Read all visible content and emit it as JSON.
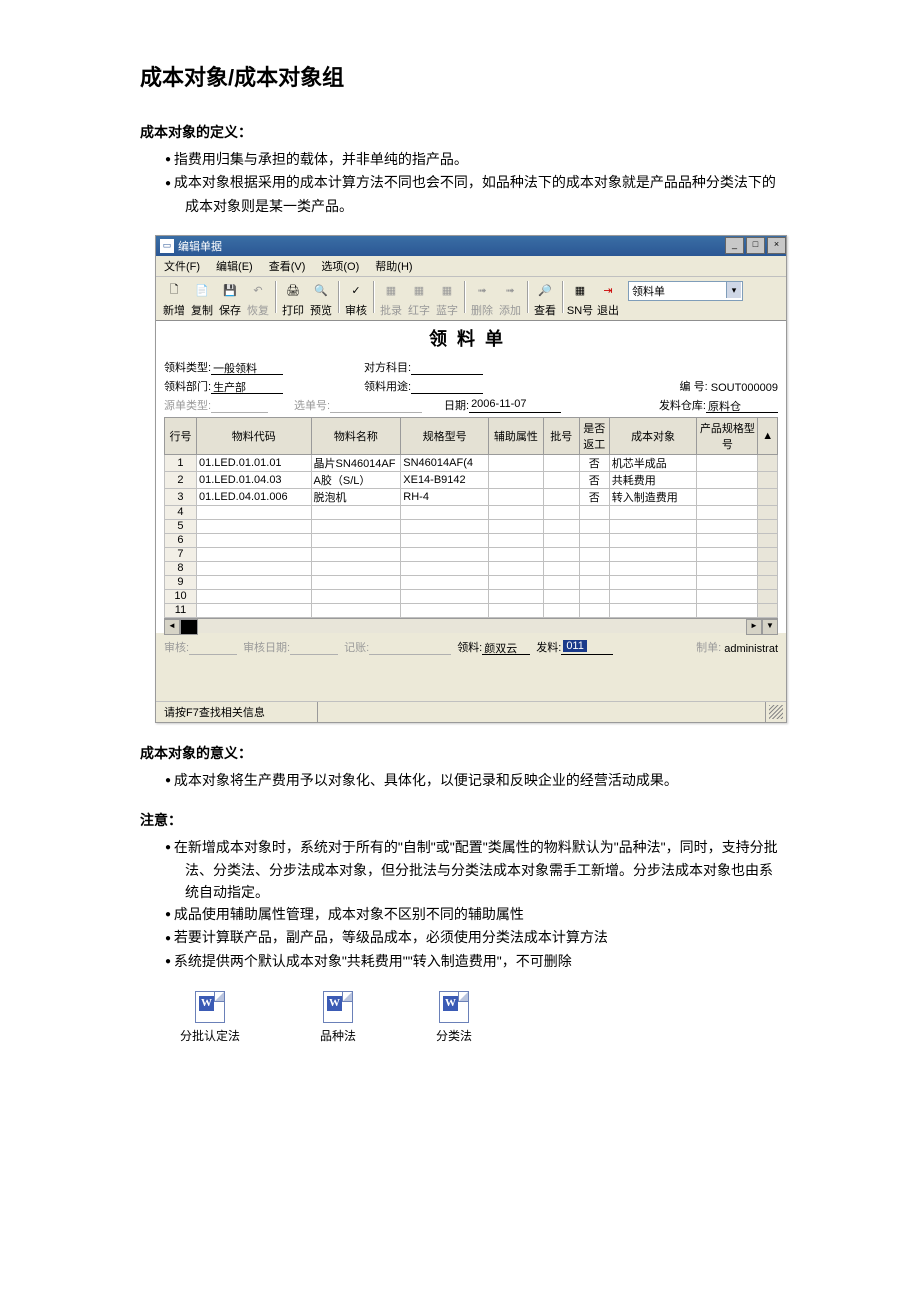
{
  "doc": {
    "title": "成本对象/成本对象组",
    "def_heading": "成本对象的定义：",
    "def_bullets": [
      "指费用归集与承担的载体，并非单纯的指产品。",
      "成本对象根据采用的成本计算方法不同也会不同，如品种法下的成本对象就是产品品种分类法下的成本对象则是某一类产品。"
    ],
    "meaning_heading": "成本对象的意义：",
    "meaning_bullets": [
      "成本对象将生产费用予以对象化、具体化，以便记录和反映企业的经营活动成果。"
    ],
    "note_heading": "注意：",
    "note_bullets": [
      "在新增成本对象时，系统对于所有的\"自制\"或\"配置\"类属性的物料默认为\"品种法\"，同时，支持分批法、分类法、分步法成本对象，但分批法与分类法成本对象需手工新增。分步法成本对象也由系统自动指定。",
      "成品使用辅助属性管理，成本对象不区别不同的辅助属性",
      "若要计算联产品，副产品，等级品成本，必须使用分类法成本计算方法",
      "系统提供两个默认成本对象\"共耗费用\"\"转入制造费用\"，不可删除"
    ],
    "word_docs": [
      "分批认定法",
      "品种法",
      "分类法"
    ]
  },
  "app": {
    "title": "编辑单据",
    "menus": {
      "file": "文件(F)",
      "edit": "编辑(E)",
      "view": "查看(V)",
      "option": "选项(O)",
      "help": "帮助(H)"
    },
    "tools": [
      "新增",
      "复制",
      "保存",
      "恢复",
      "打印",
      "预览",
      "审核",
      "批录",
      "红字",
      "蓝字",
      "删除",
      "添加",
      "查看",
      "SN号",
      "退出"
    ],
    "combo": "领料单",
    "form": {
      "doc_title": "领料单",
      "fields": {
        "type_label": "领料类型:",
        "type_value": "一般领料",
        "dept_label": "领料部门:",
        "dept_value": "生产部",
        "account_label": "对方科目:",
        "account_value": "",
        "purpose_label": "领料用途:",
        "purpose_value": "",
        "no_label": "编       号:",
        "no_value": "SOUT000009",
        "src_label": "源单类型:",
        "src_value": "",
        "selno_label": "选单号:",
        "selno_value": "",
        "date_label": "日期:",
        "date_value": "2006-11-07",
        "store_label": "发料仓库:",
        "store_value": "原料仓"
      },
      "columns": [
        "行号",
        "物料代码",
        "物料名称",
        "规格型号",
        "辅助属性",
        "批号",
        "是否返工",
        "成本对象",
        "产品规格型号"
      ],
      "rows": [
        {
          "n": "1",
          "code": "01.LED.01.01.01",
          "name": "晶片SN46014AF",
          "spec": "SN46014AF(4",
          "aux": "",
          "batch": "",
          "rework": "否",
          "obj": "机芯半成品",
          "pspec": ""
        },
        {
          "n": "2",
          "code": "01.LED.01.04.03",
          "name": "A胶（S/L）",
          "spec": "XE14-B9142",
          "aux": "",
          "batch": "",
          "rework": "否",
          "obj": "共耗费用",
          "pspec": ""
        },
        {
          "n": "3",
          "code": "01.LED.04.01.006",
          "name": "脱泡机",
          "spec": "RH-4",
          "aux": "",
          "batch": "",
          "rework": "否",
          "obj": "转入制造费用",
          "pspec": ""
        }
      ],
      "empty_rows": [
        "4",
        "5",
        "6",
        "7",
        "8",
        "9",
        "10",
        "11"
      ],
      "footer": {
        "audit_label": "审核:",
        "audit_value": "",
        "audit_date_label": "审核日期:",
        "audit_date_value": "",
        "post_label": "记账:",
        "post_value": "",
        "recv_label": "领料:",
        "recv_value": "颜双云",
        "issue_label": "发料:",
        "issue_value": "011",
        "maker_label": "制单:",
        "maker_value": "administrat"
      }
    },
    "status": "请按F7查找相关信息"
  }
}
